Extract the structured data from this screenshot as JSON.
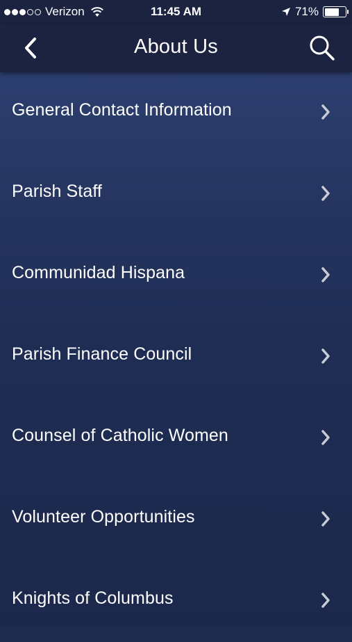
{
  "status_bar": {
    "carrier": "Verizon",
    "time": "11:45 AM",
    "battery_percent": "71%",
    "battery_level": 0.71,
    "signal_bars_filled": 3,
    "signal_bars_total": 5
  },
  "nav": {
    "title": "About Us",
    "back_icon": "chevron-left-icon",
    "search_icon": "search-icon"
  },
  "menu": {
    "items": [
      {
        "label": "General Contact Information"
      },
      {
        "label": "Parish Staff"
      },
      {
        "label": "Communidad Hispana"
      },
      {
        "label": "Parish Finance Council"
      },
      {
        "label": "Counsel of Catholic Women"
      },
      {
        "label": "Volunteer Opportunities"
      },
      {
        "label": "Knights of Columbus"
      }
    ]
  },
  "colors": {
    "nav_background": "#1b2340",
    "list_top": "#2d3f70",
    "list_bottom": "#1c284b",
    "chevron": "#c8ccd6",
    "text": "#ffffff"
  }
}
